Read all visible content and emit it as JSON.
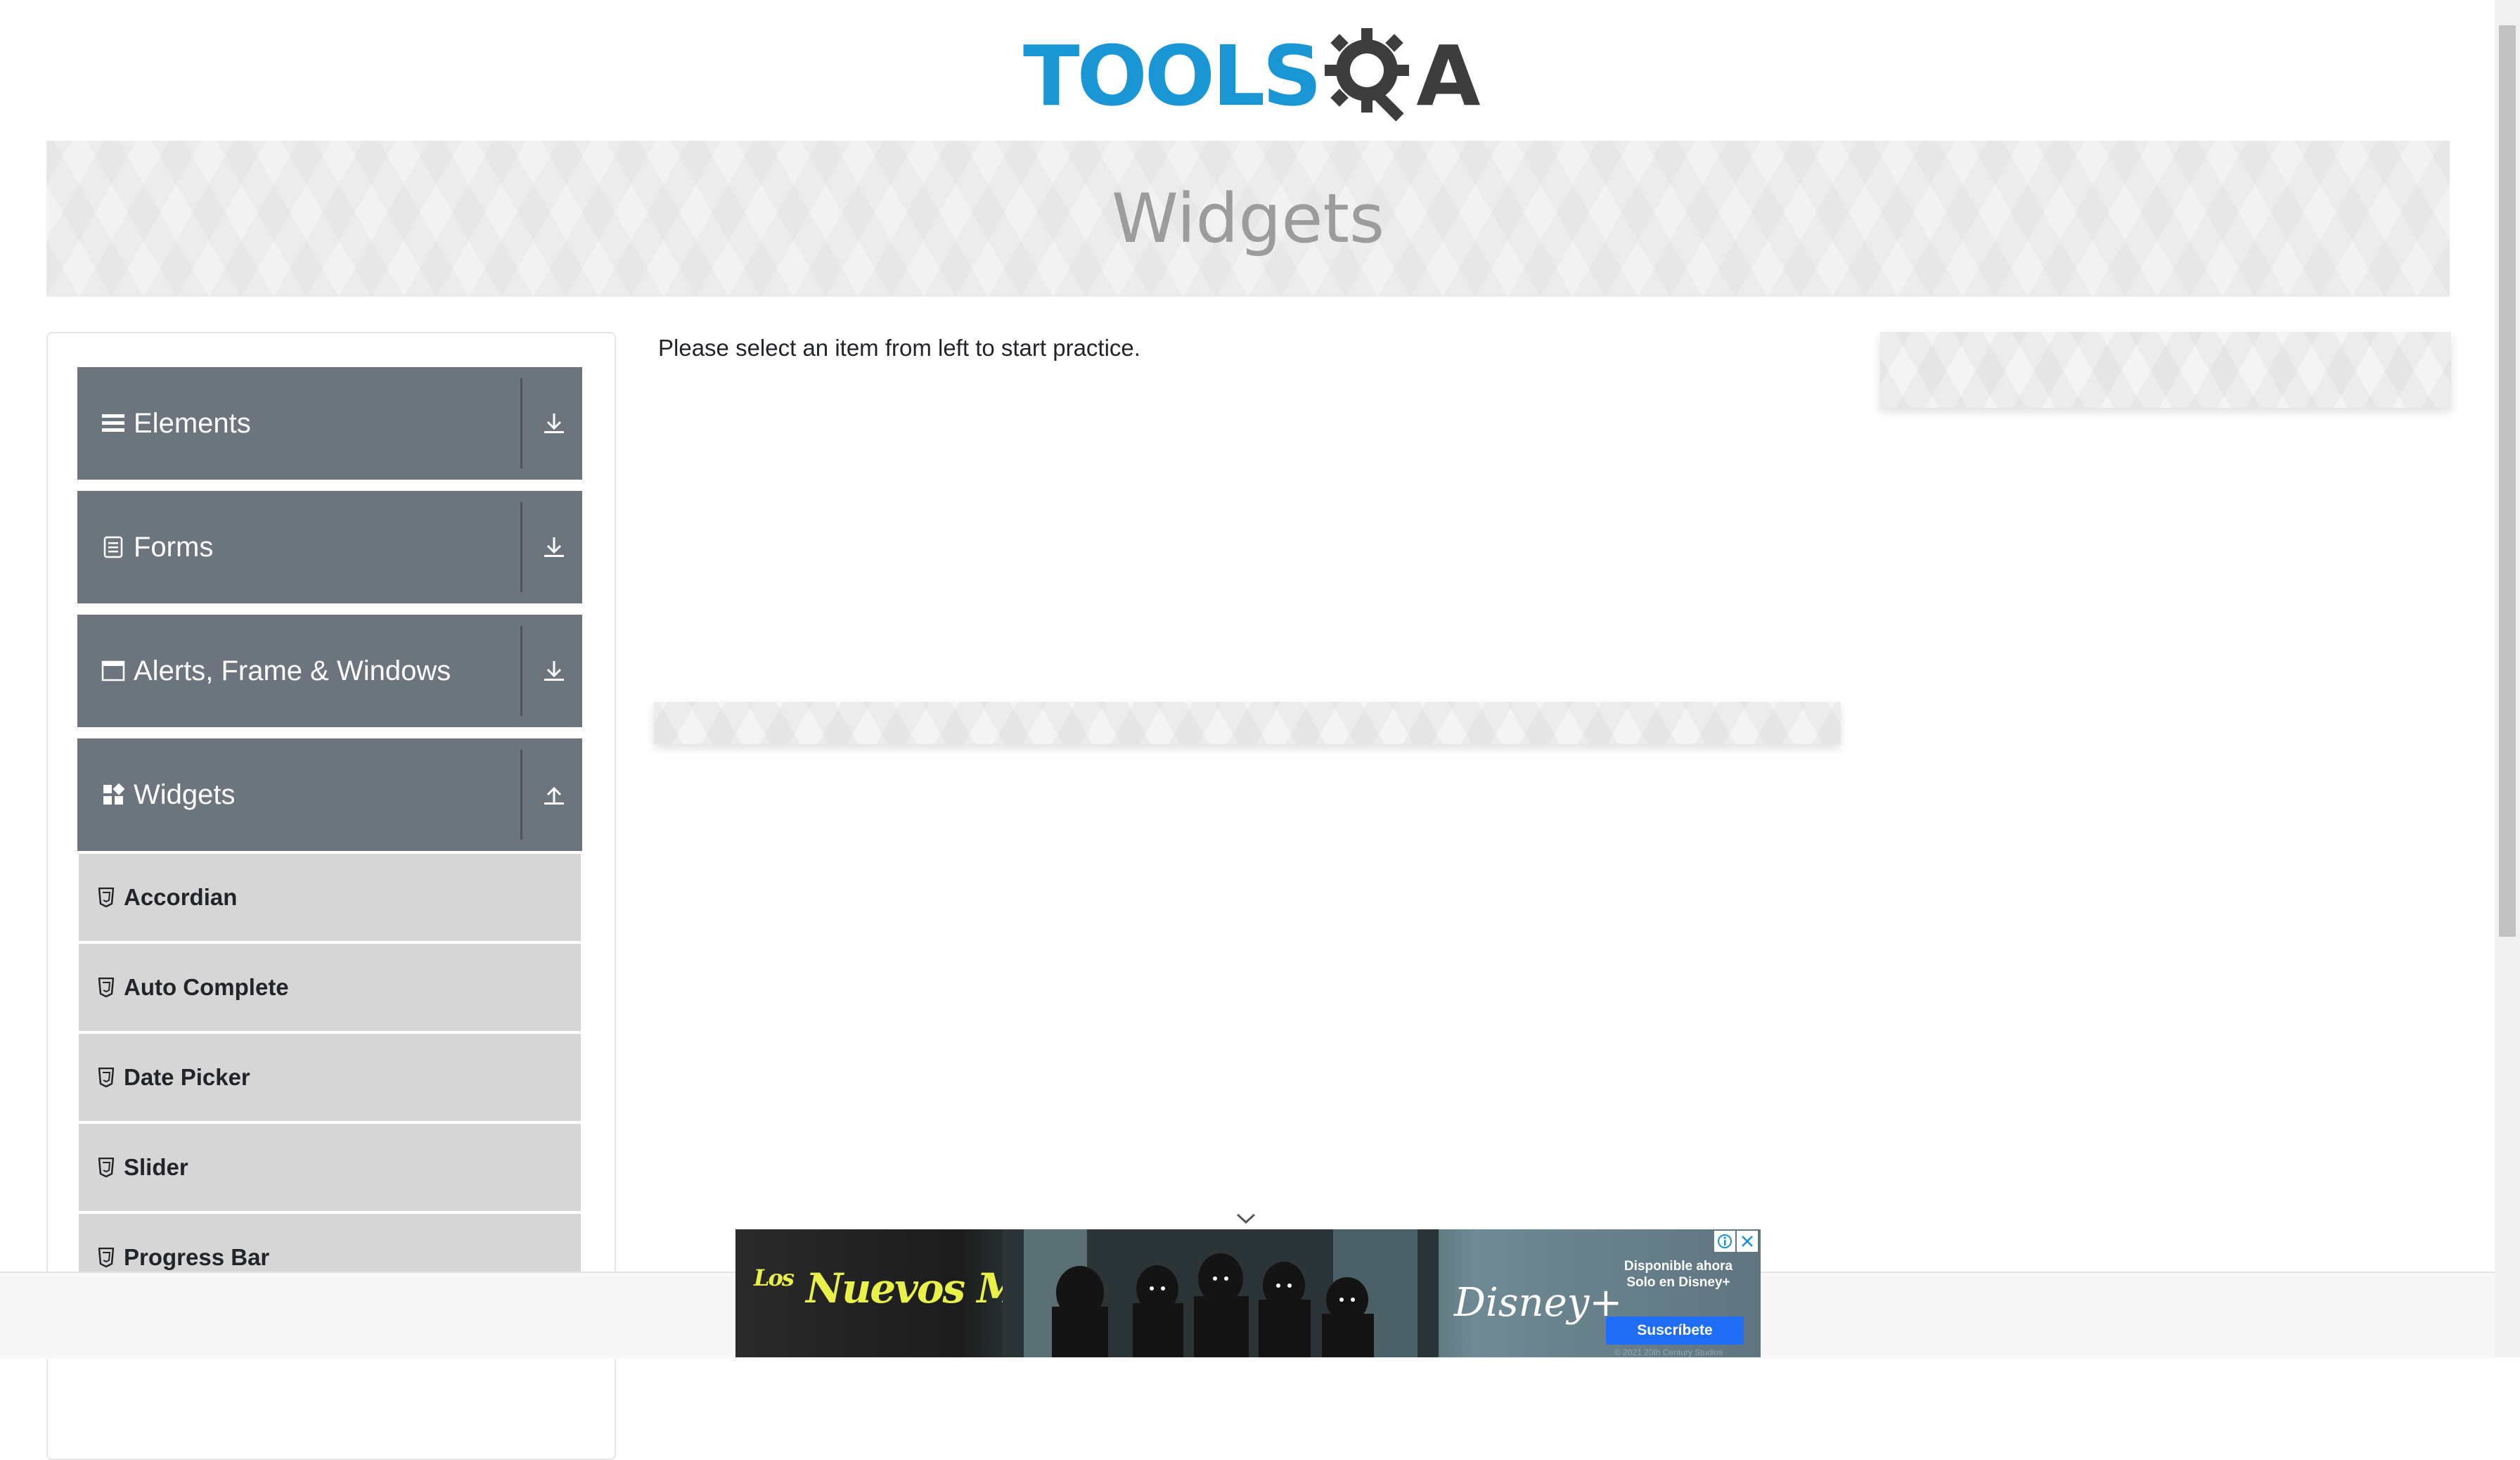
{
  "header": {
    "logo_text_tools": "TOOLS",
    "logo_text_q": "Q",
    "logo_text_a": "A"
  },
  "banner": {
    "title": "Widgets"
  },
  "sidebar": {
    "groups": [
      {
        "label": "Elements",
        "icon": "menu-icon",
        "toggle_icon": "download-arrow-icon",
        "expanded": false
      },
      {
        "label": "Forms",
        "icon": "document-icon",
        "toggle_icon": "download-arrow-icon",
        "expanded": false
      },
      {
        "label": "Alerts, Frame & Windows",
        "icon": "window-icon",
        "toggle_icon": "download-arrow-icon",
        "expanded": false
      },
      {
        "label": "Widgets",
        "icon": "widgets-icon",
        "toggle_icon": "upload-arrow-icon",
        "expanded": true
      }
    ],
    "items": [
      {
        "label": "Accordian",
        "icon": "html5-icon"
      },
      {
        "label": "Auto Complete",
        "icon": "html5-icon"
      },
      {
        "label": "Date Picker",
        "icon": "html5-icon"
      },
      {
        "label": "Slider",
        "icon": "html5-icon"
      },
      {
        "label": "Progress Bar",
        "icon": "html5-icon"
      }
    ]
  },
  "main": {
    "instruction": "Please select an item from left to start practice."
  },
  "ad": {
    "title": "Nuevos Mutantes",
    "title_prefix": "Los",
    "brand": "Disney",
    "brand_plus": "+",
    "tagline": "Disponible ahora Solo en Disney+",
    "cta": "Suscríbete",
    "fine_print": "© 2021 20th Century Studios"
  },
  "colors": {
    "logo_blue": "#1a96d4",
    "logo_dark": "#3d3d3d",
    "group_bg": "#6c757d",
    "item_bg": "#d6d6d6",
    "ad_cta": "#1f6cf5"
  }
}
